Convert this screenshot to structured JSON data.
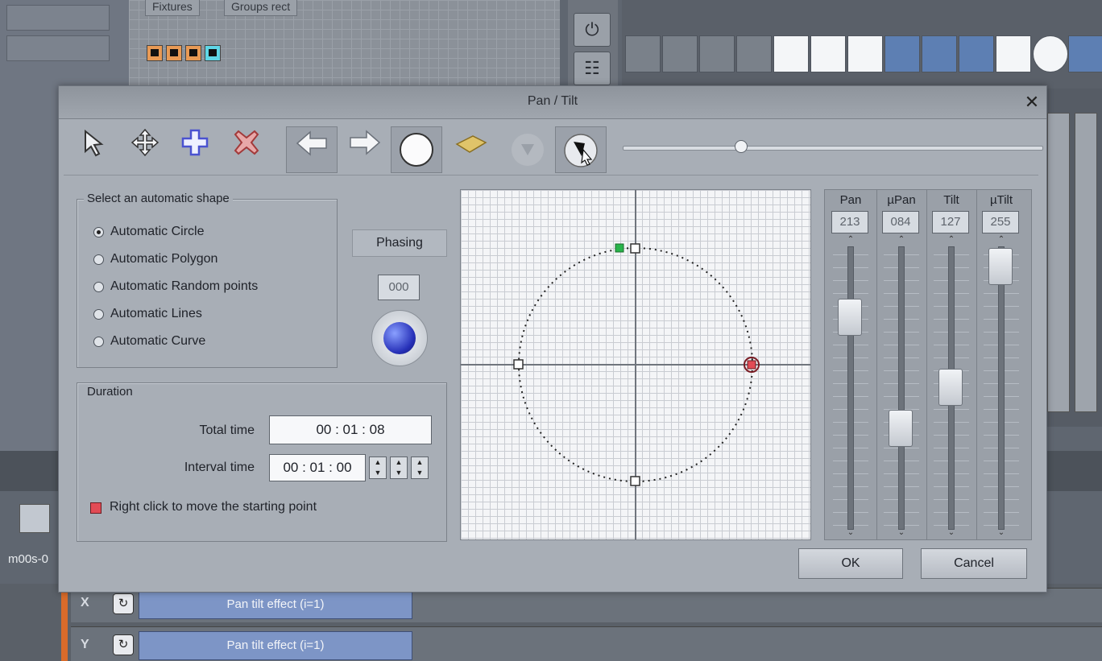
{
  "background": {
    "tabs": [
      "Fixtures",
      "Groups rect"
    ],
    "sequence_label": "m00s-0",
    "sequence_rows": [
      {
        "letter": "X",
        "clip": "Pan tilt effect (i=1)"
      },
      {
        "letter": "Y",
        "clip": "Pan tilt effect (i=1)"
      }
    ]
  },
  "dialog": {
    "title": "Pan / Tilt",
    "close_icon": "close-icon",
    "toolbar": {
      "tools": [
        {
          "name": "select-arrow-icon",
          "glyph": "⇱"
        },
        {
          "name": "move-cross-icon",
          "glyph": "✥"
        },
        {
          "name": "add-point-icon",
          "glyph": "✚"
        },
        {
          "name": "delete-point-icon",
          "glyph": "✖"
        },
        {
          "name": "arrow-left-icon",
          "glyph": "⇦"
        },
        {
          "name": "arrow-right-icon",
          "glyph": "⇨"
        },
        {
          "name": "circle-shape-icon",
          "glyph": "●"
        },
        {
          "name": "map-icon",
          "glyph": "▰"
        },
        {
          "name": "fade-down-icon",
          "glyph": "▼"
        },
        {
          "name": "cursor-pointer-icon",
          "glyph": "➤"
        }
      ],
      "speed_slider_fraction": 0.28
    },
    "shapes": {
      "legend": "Select an automatic shape",
      "options": [
        {
          "label": "Automatic Circle",
          "selected": true
        },
        {
          "label": "Automatic Polygon",
          "selected": false
        },
        {
          "label": "Automatic Random points",
          "selected": false
        },
        {
          "label": "Automatic Lines",
          "selected": false
        },
        {
          "label": "Automatic Curve",
          "selected": false
        }
      ]
    },
    "phasing": {
      "label": "Phasing",
      "value": "000"
    },
    "duration": {
      "legend": "Duration",
      "total_label": "Total time",
      "total_value": "00 : 01 : 08",
      "interval_label": "Interval time",
      "interval_value": "00 : 01 : 00",
      "hint": "Right click to move the starting point"
    },
    "faders": [
      {
        "label": "Pan",
        "value": "213",
        "level": 0.79
      },
      {
        "label": "µPan",
        "value": "084",
        "level": 0.33
      },
      {
        "label": "Tilt",
        "value": "127",
        "level": 0.5
      },
      {
        "label": "µTilt",
        "value": "255",
        "level": 1.0
      }
    ],
    "buttons": {
      "ok": "OK",
      "cancel": "Cancel"
    },
    "colors": {
      "start_point": "#e24b55",
      "first_point": "#28b44a",
      "knob": "#2630b8"
    }
  }
}
